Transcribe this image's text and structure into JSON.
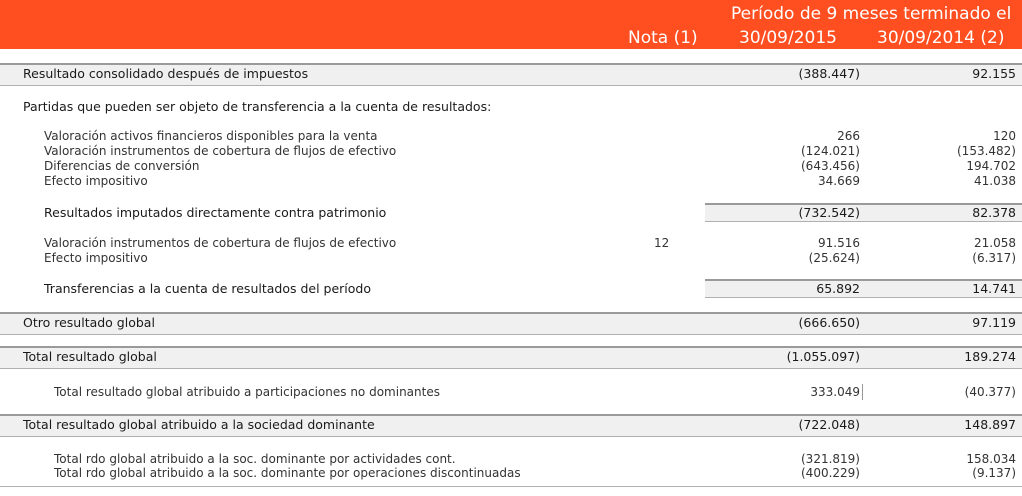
{
  "header": {
    "period_title": "Período de 9 meses terminado el",
    "nota": "Nota (1)",
    "col1": "30/09/2015",
    "col2": "30/09/2014 (2)"
  },
  "rows": {
    "resultado_consolidado": {
      "label": "Resultado consolidado después de impuestos",
      "v2015": "(388.447)",
      "v2014": "92.155"
    },
    "partidas_title": "Partidas que pueden ser objeto de transferencia a la cuenta de resultados:",
    "valoracion_activos": {
      "label": "Valoración activos financieros disponibles para la venta",
      "v2015": "266",
      "v2014": "120"
    },
    "valoracion_cobertura": {
      "label": "Valoración instrumentos de cobertura de flujos de efectivo",
      "v2015": "(124.021)",
      "v2014": "(153.482)"
    },
    "diferencias": {
      "label": "Diferencias de conversión",
      "v2015": "(643.456)",
      "v2014": "194.702"
    },
    "efecto1": {
      "label": "Efecto impositivo",
      "v2015": "34.669",
      "v2014": "41.038"
    },
    "resultados_imputados": {
      "label": "Resultados imputados directamente contra patrimonio",
      "v2015": "(732.542)",
      "v2014": "82.378"
    },
    "valoracion_cobertura2": {
      "label": "Valoración instrumentos de cobertura de flujos de efectivo",
      "nota": "12",
      "v2015": "91.516",
      "v2014": "21.058"
    },
    "efecto2": {
      "label": "Efecto impositivo",
      "v2015": "(25.624)",
      "v2014": "(6.317)"
    },
    "transferencias": {
      "label": "Transferencias a la cuenta de resultados del período",
      "v2015": "65.892",
      "v2014": "14.741"
    },
    "otro_resultado": {
      "label": "Otro resultado global",
      "v2015": "(666.650)",
      "v2014": "97.119"
    },
    "total_resultado": {
      "label": "Total resultado global",
      "v2015": "(1.055.097)",
      "v2014": "189.274"
    },
    "no_dominantes": {
      "label": "Total resultado global atribuido a participaciones no dominantes",
      "v2015": "333.049",
      "v2014": "(40.377)"
    },
    "sociedad_dominante": {
      "label": "Total resultado global atribuido a la sociedad dominante",
      "v2015": "(722.048)",
      "v2014": "148.897"
    },
    "act_cont": {
      "label": "Total rdo global atribuido a la soc. dominante por actividades cont.",
      "v2015": "(321.819)",
      "v2014": "158.034"
    },
    "op_disc": {
      "label": "Total rdo global atribuido a la soc. dominante por operaciones discontinuadas",
      "v2015": "(400.229)",
      "v2014": "(9.137)"
    }
  }
}
